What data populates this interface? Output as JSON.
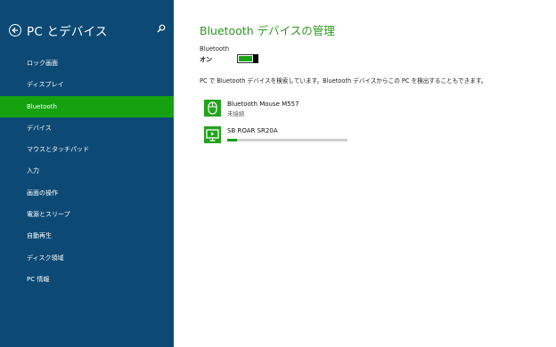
{
  "sidebar": {
    "title": "PC とデバイス",
    "items": [
      {
        "label": "ロック画面"
      },
      {
        "label": "ディスプレイ"
      },
      {
        "label": "Bluetooth"
      },
      {
        "label": "デバイス"
      },
      {
        "label": "マウスとタッチパッド"
      },
      {
        "label": "入力"
      },
      {
        "label": "画面の操作"
      },
      {
        "label": "電源とスリープ"
      },
      {
        "label": "自動再生"
      },
      {
        "label": "ディスク領域"
      },
      {
        "label": "PC 情報"
      }
    ],
    "active_index": 2
  },
  "main": {
    "title": "Bluetooth デバイスの管理",
    "bluetooth_label": "Bluetooth",
    "bluetooth_state": "オン",
    "toggle_on": true,
    "description": "PC で Bluetooth デバイスを検索しています。Bluetooth デバイスからこの PC を検出することもできます。",
    "devices": [
      {
        "name": "Bluetooth Mouse M557",
        "status": "未接続",
        "icon": "mouse-icon"
      },
      {
        "name": "SB ROAR SR20A",
        "progress": 0.08,
        "icon": "display-device-icon"
      }
    ]
  },
  "colors": {
    "sidebar_bg": "#0c4a75",
    "accent_green": "#15a110",
    "title_green": "#2b9a1f"
  }
}
